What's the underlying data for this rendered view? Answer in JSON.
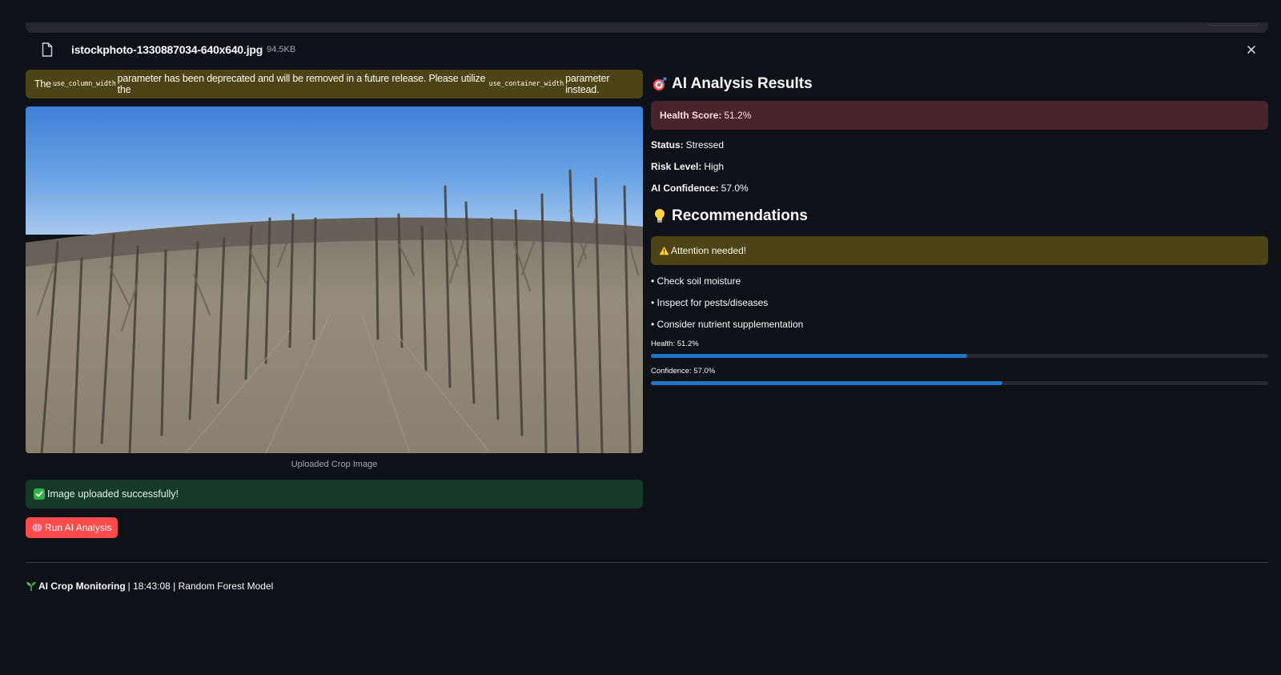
{
  "uploader": {
    "file_name": "istockphoto-1330887034-640x640.jpg",
    "file_size": "94.5KB",
    "file_icon": "file-icon",
    "close_icon": "close-icon"
  },
  "deprecation_warning": {
    "prefix": "The",
    "param_old": "use_column_width",
    "middle": "parameter has been deprecated and will be removed in a future release. Please utilize the",
    "param_new": "use_container_width",
    "suffix": "parameter instead."
  },
  "image": {
    "caption": "Uploaded Crop Image"
  },
  "upload_status": {
    "icon": "check-icon",
    "text": "Image uploaded successfully!"
  },
  "run_button": {
    "icon": "brain-icon",
    "label": "Run AI Analysis"
  },
  "results": {
    "heading_icon": "target-icon",
    "heading": "AI Analysis Results",
    "health_score_label": "Health Score:",
    "health_score_value": "51.2%",
    "status_label": "Status:",
    "status_value": "Stressed",
    "risk_label": "Risk Level:",
    "risk_value": "High",
    "confidence_label": "AI Confidence:",
    "confidence_value": "57.0%"
  },
  "recommendations": {
    "heading_icon": "lightbulb-icon",
    "heading": "Recommendations",
    "alert_icon": "warning-icon",
    "alert_text": "Attention needed!",
    "items": [
      "• Check soil moisture",
      "• Inspect for pests/diseases",
      "• Consider nutrient supplementation"
    ]
  },
  "progress": {
    "health_label": "Health: 51.2%",
    "health_fraction": 0.512,
    "confidence_label": "Confidence: 57.0%",
    "confidence_fraction": 0.57
  },
  "footer": {
    "icon": "seedling-icon",
    "app_name": "AI Crop Monitoring",
    "details": "| 18:43:08 | Random Forest Model"
  },
  "colors": {
    "background": "#0e1117",
    "primary_button": "#ff4b4b",
    "progress_fill": "#1f75c4",
    "warning_bg": "#4c4417",
    "error_bg": "#4b232b",
    "success_bg": "#173928"
  }
}
